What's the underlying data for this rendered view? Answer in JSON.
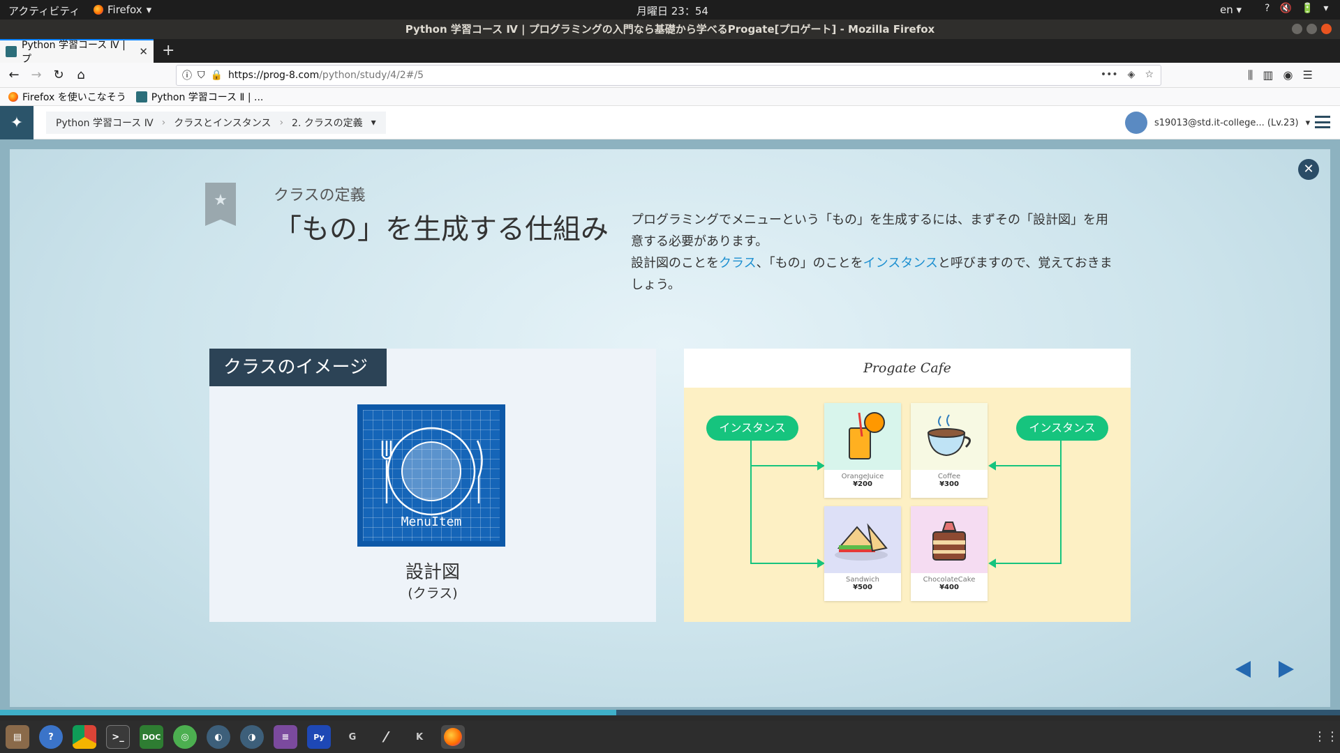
{
  "system": {
    "activities": "アクティビティ",
    "app_menu": "Firefox",
    "clock": "月曜日 23：54",
    "lang": "en",
    "tray": [
      "?",
      "🔇",
      "🔋",
      "▾"
    ]
  },
  "window": {
    "title": "Python 学習コース Ⅳ | プログラミングの入門なら基礎から学べるProgate[プロゲート] - Mozilla Firefox"
  },
  "tabs": [
    {
      "label": "Python 学習コース Ⅳ | プ"
    }
  ],
  "nav": {
    "url_host": "https://prog-8.com",
    "url_path": "/python/study/4/2#/5"
  },
  "bookmarks": [
    {
      "label": "Firefox を使いこなそう"
    },
    {
      "label": "Python 学習コース Ⅱ | ..."
    }
  ],
  "progate": {
    "breadcrumbs": [
      "Python 学習コース Ⅳ",
      "クラスとインスタンス",
      "2. クラスの定義"
    ],
    "user": "s19013@std.it-college... (Lv.23)"
  },
  "slide": {
    "subtitle": "クラスの定義",
    "heading": "「もの」を生成する仕組み",
    "desc": {
      "p1": "プログラミングでメニューという「もの」を生成するには、まずその「設計図」を用意する必要があります。",
      "p2_a": "設計図のことを",
      "p2_link1": "クラス",
      "p2_b": "、「もの」のことを",
      "p2_link2": "インスタンス",
      "p2_c": "と呼びますので、覚えておきましょう。"
    },
    "class_panel": {
      "tag": "クラスのイメージ",
      "blueprint_label": "MenuItem",
      "label": "設計図",
      "sub": "(クラス)"
    },
    "cafe_panel": {
      "title": "Progate Cafe",
      "instance_label": "インスタンス",
      "items": [
        {
          "name": "OrangeJuice",
          "price": "¥200",
          "bg": "#d8f5ec"
        },
        {
          "name": "Coffee",
          "price": "¥300",
          "bg": "#f7f9e3"
        },
        {
          "name": "Sandwich",
          "price": "¥500",
          "bg": "#dde0f7"
        },
        {
          "name": "ChocolateCake",
          "price": "¥400",
          "bg": "#f5dcf2"
        }
      ]
    },
    "progress": 0.46
  },
  "dock": [
    "files",
    "help",
    "chrome",
    "terminal",
    "doc",
    "app",
    "app2",
    "app3",
    "editor",
    "pyzm",
    "G",
    "slash",
    "K",
    "firefox"
  ],
  "colors": {
    "accent": "#16c47e",
    "header_dark": "#2c4356",
    "link": "#1c8fd0"
  }
}
